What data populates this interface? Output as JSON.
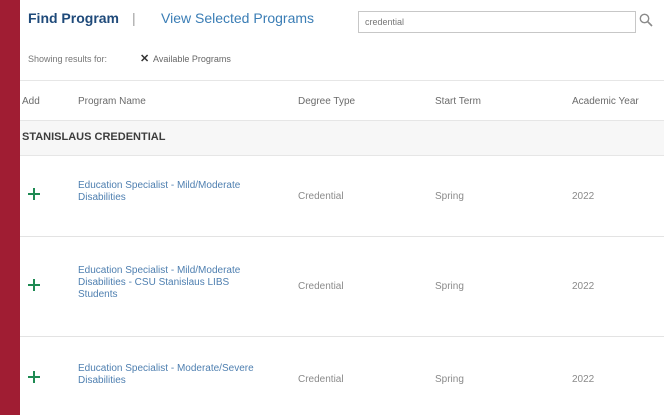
{
  "nav": {
    "find_program": "Find Program",
    "separator": "|",
    "view_selected": "View Selected Programs"
  },
  "search": {
    "value": "credential",
    "placeholder": ""
  },
  "filter": {
    "label": "Showing results for:",
    "chip_label": "Available Programs"
  },
  "table": {
    "columns": [
      "Add",
      "Program Name",
      "Degree Type",
      "Start Term",
      "Academic Year"
    ],
    "group": "STANISLAUS CREDENTIAL",
    "rows": [
      {
        "program": "Education Specialist - Mild/Moderate Disabilities",
        "degree": "Credential",
        "term": "Spring",
        "year": "2022"
      },
      {
        "program": "Education Specialist - Mild/Moderate Disabilities - CSU Stanislaus LIBS Students",
        "degree": "Credential",
        "term": "Spring",
        "year": "2022"
      },
      {
        "program": "Education Specialist - Moderate/Severe Disabilities",
        "degree": "Credential",
        "term": "Spring",
        "year": "2022"
      }
    ]
  },
  "colors": {
    "accent": "#a01d33",
    "link": "#4e7fb0",
    "add": "#1e8a53",
    "nav_active": "#1f4a7a"
  },
  "icons": {
    "search": "search-icon",
    "remove": "close-icon",
    "add": "plus-icon"
  }
}
